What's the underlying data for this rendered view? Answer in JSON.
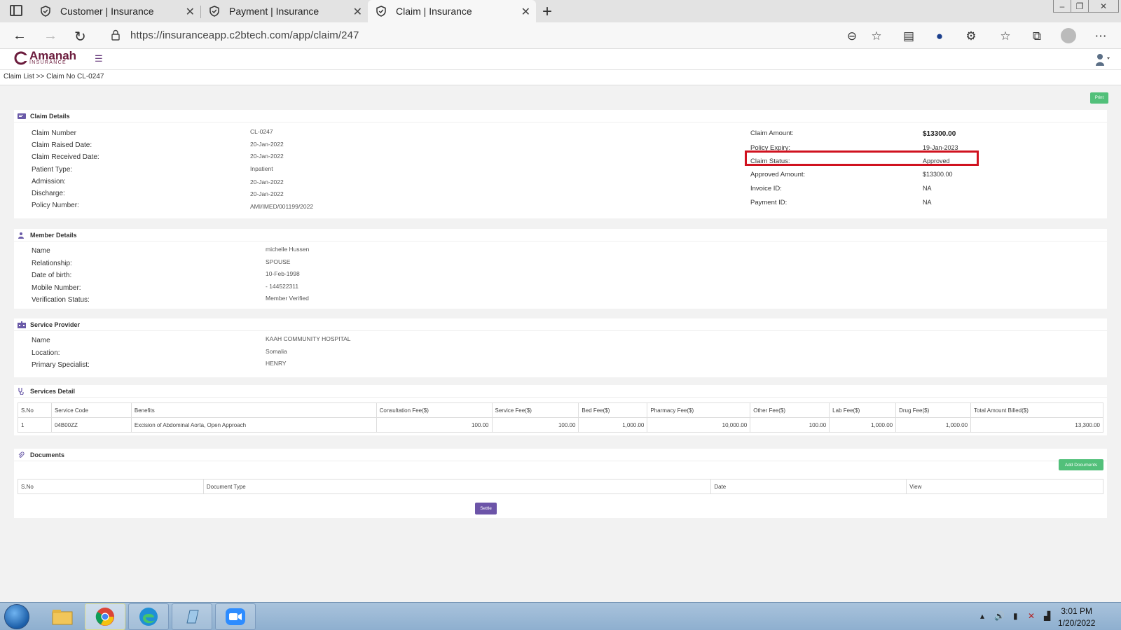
{
  "browser": {
    "tabs": [
      {
        "title": "Customer | Insurance"
      },
      {
        "title": "Payment | Insurance"
      },
      {
        "title": "Claim | Insurance"
      }
    ],
    "url": "https://insuranceapp.c2btech.com/app/claim/247"
  },
  "app": {
    "logo_text": "Amanah",
    "logo_sub": "INSURANCE",
    "breadcrumb": "Claim List >> Claim No CL-0247",
    "print_label": "Print"
  },
  "claim_details": {
    "title": "Claim Details",
    "left": [
      {
        "label": "Claim Number",
        "value": "CL-0247"
      },
      {
        "label": "Claim Raised Date:",
        "value": "20-Jan-2022"
      },
      {
        "label": "Claim Received Date:",
        "value": "20-Jan-2022"
      },
      {
        "label": "Patient Type:",
        "value": "Inpatient"
      },
      {
        "label": "Admission:",
        "value": "20-Jan-2022"
      },
      {
        "label": "Discharge:",
        "value": "20-Jan-2022"
      },
      {
        "label": "Policy Number:",
        "value": "AMI/IMED/001199/2022"
      }
    ],
    "right": [
      {
        "label": "Claim Amount:",
        "value": "$13300.00"
      },
      {
        "label": "Policy Expiry:",
        "value": "19-Jan-2023"
      },
      {
        "label": "Claim Status:",
        "value": "Approved"
      },
      {
        "label": "Approved Amount:",
        "value": "$13300.00"
      },
      {
        "label": "Invoice ID:",
        "value": "NA"
      },
      {
        "label": "Payment ID:",
        "value": "NA"
      }
    ]
  },
  "member_details": {
    "title": "Member Details",
    "rows": [
      {
        "label": "Name",
        "value": "michelle Hussen"
      },
      {
        "label": "Relationship:",
        "value": "SPOUSE"
      },
      {
        "label": "Date of birth:",
        "value": "10-Feb-1998"
      },
      {
        "label": "Mobile Number:",
        "value": "- 144522311"
      },
      {
        "label": "Verification Status:",
        "value": "Member Verified"
      }
    ]
  },
  "service_provider": {
    "title": "Service Provider",
    "rows": [
      {
        "label": "Name",
        "value": "KAAH COMMUNITY HOSPITAL"
      },
      {
        "label": "Location:",
        "value": "Somalia"
      },
      {
        "label": "Primary Specialist:",
        "value": "HENRY"
      }
    ]
  },
  "services_detail": {
    "title": "Services Detail",
    "headers": [
      "S.No",
      "Service Code",
      "Benefits",
      "Consultation Fee($)",
      "Service Fee($)",
      "Bed Fee($)",
      "Pharmacy Fee($)",
      "Other Fee($)",
      "Lab Fee($)",
      "Drug Fee($)",
      "Total Amount Billed($)"
    ],
    "row": [
      "1",
      "04B00ZZ",
      "Excision of Abdominal Aorta, Open Approach",
      "100.00",
      "100.00",
      "1,000.00",
      "10,000.00",
      "100.00",
      "1,000.00",
      "1,000.00",
      "13,300.00"
    ]
  },
  "documents": {
    "title": "Documents",
    "add_label": "Add Documents",
    "headers": [
      "S.No",
      "Document Type",
      "Date",
      "View"
    ],
    "settle_label": "Settle"
  },
  "taskbar": {
    "time": "3:01 PM",
    "date": "1/20/2022"
  }
}
